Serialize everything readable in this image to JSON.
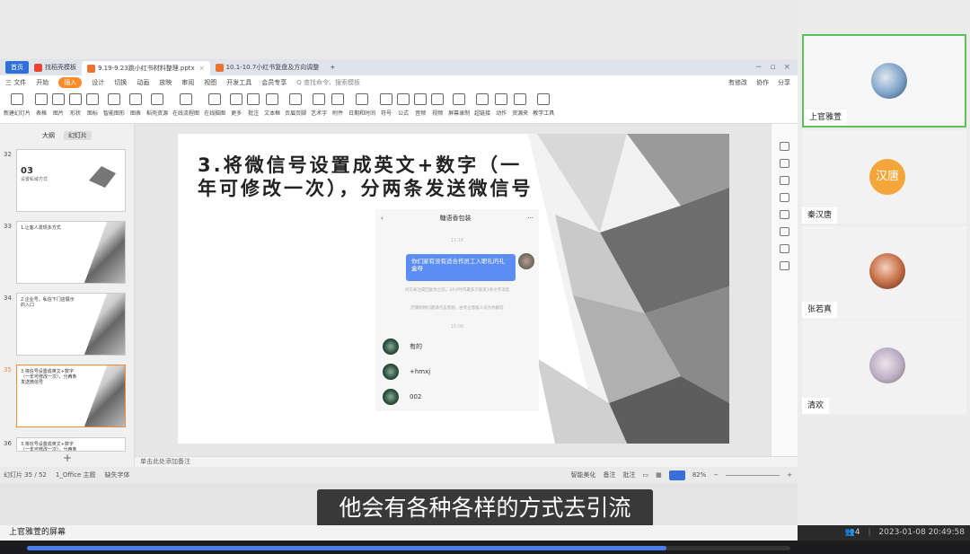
{
  "tabs": {
    "home": "首页",
    "tab1": "找稻壳模板",
    "tab2": "9.19-9.23跳小红书材料整理.pptx",
    "tab3": "10.1-10.7小红书复盘及方向调整",
    "add": "+"
  },
  "menu": {
    "file": "三 文件",
    "items": [
      "开始",
      "插入",
      "设计",
      "切换",
      "动画",
      "放映",
      "审阅",
      "视图",
      "开发工具",
      "会员专享"
    ],
    "search": "Q 查找命令、搜索模板",
    "right": [
      "有修改",
      "协作",
      "分享"
    ]
  },
  "toolbar": [
    "新建幻灯片",
    "表格",
    "图片",
    "形状",
    "图标",
    "智能图形",
    "图表",
    "稻壳资源",
    "在线流程图",
    "在线脑图",
    "更多",
    "批注",
    "文本框",
    "页眉页脚",
    "艺术字",
    "附件",
    "日期和时间",
    "符号",
    "公式",
    "音频",
    "视频",
    "屏幕录制",
    "超链接",
    "动作",
    "资源夹",
    "教学工具"
  ],
  "left_panel": {
    "tab_outline": "大纲",
    "tab_slides": "幻灯片",
    "slides": [
      {
        "num": "32",
        "title": "03",
        "subtitle": "设置私域方式"
      },
      {
        "num": "33",
        "title": "1.让客人发现多方式"
      },
      {
        "num": "34",
        "title": "2.企业号，私信下门店展示的入口"
      },
      {
        "num": "35",
        "title": "3.将信号设置成英文+数字（一年可修改一次），分两条发送微信号"
      },
      {
        "num": "36",
        "title": "3.将信号设置成英文+数字（一年可修改一次），分两条"
      }
    ],
    "add_label": "+"
  },
  "slide": {
    "title": "3.将微信号设置成英文+数字（一年可修改一次），分两条发送微信号",
    "phone": {
      "contact": "糖语香包装",
      "time1": "11:16",
      "message": "你们家有没有适合作员工入职礼的礼盒呀",
      "system1": "对方关注或回复你之前，24小时内最多只能发1条文字消息",
      "system2": "店铺购物问题请点击客服，由专业客服人员为你解答",
      "time2": "15:06",
      "replies": [
        "有的",
        "+hmxj",
        "002"
      ]
    }
  },
  "notes_placeholder": "单击此处添加备注",
  "statusbar": {
    "slide_pos": "幻灯片 35 / 52",
    "theme": "1_Office 主题",
    "font_missing": "缺失字体",
    "beautify": "智能美化",
    "notes": "备注",
    "comments": "批注",
    "zoom": "82%"
  },
  "subtitle": "他会有各种各样的方式去引流",
  "screen_share_label": "上官雅萱的屏幕",
  "participants": [
    {
      "name": "上官雅萱",
      "avatar_color": "#7fa3c9",
      "active": true
    },
    {
      "name": "秦汉唐",
      "avatar_text": "汉唐",
      "avatar_color": "#f5a63a",
      "active": false
    },
    {
      "name": "张若真",
      "avatar_color": "#c9734a",
      "active": false
    },
    {
      "name": "清欢",
      "avatar_color": "#b9b0c6",
      "active": false
    }
  ],
  "meeting": {
    "count": "4",
    "datetime": "2023-01-08 20:49:58"
  },
  "playback": {
    "progress": 0.838
  }
}
